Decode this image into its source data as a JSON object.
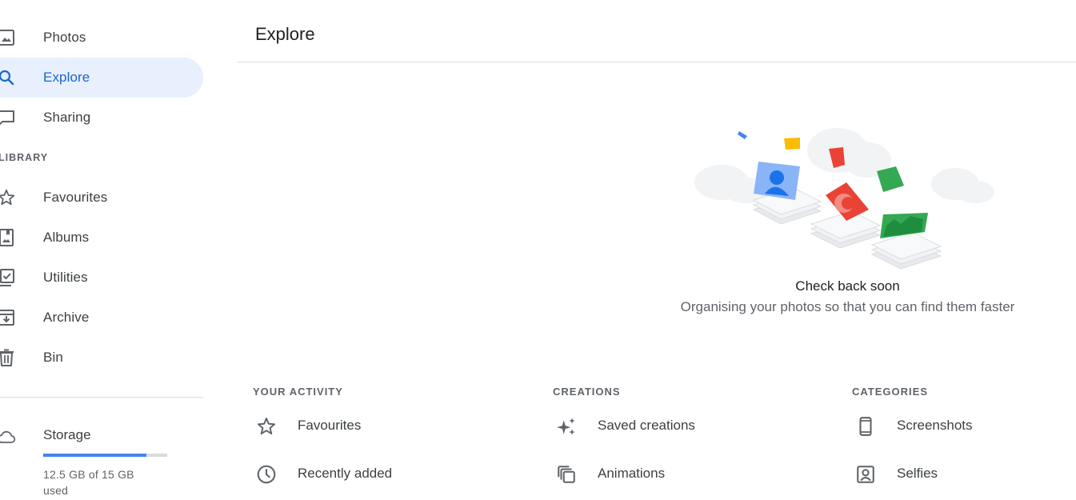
{
  "sidebar": {
    "items": [
      {
        "label": "Photos",
        "icon": "photo-icon"
      },
      {
        "label": "Explore",
        "icon": "search-icon",
        "active": true
      },
      {
        "label": "Sharing",
        "icon": "sharing-icon"
      }
    ],
    "library_label": "LIBRARY",
    "library_items": [
      {
        "label": "Favourites",
        "icon": "star-icon"
      },
      {
        "label": "Albums",
        "icon": "album-icon"
      },
      {
        "label": "Utilities",
        "icon": "utilities-icon"
      },
      {
        "label": "Archive",
        "icon": "archive-icon"
      },
      {
        "label": "Bin",
        "icon": "bin-icon"
      }
    ],
    "storage": {
      "label": "Storage",
      "usage_text": "12.5 GB of 15 GB used",
      "used_fraction": 0.833,
      "icon": "cloud-icon"
    }
  },
  "main": {
    "title": "Explore",
    "empty_state": {
      "title": "Check back soon",
      "subtitle": "Organising your photos so that you can find them faster"
    },
    "columns": [
      {
        "title": "YOUR ACTIVITY",
        "items": [
          {
            "label": "Favourites",
            "icon": "star-icon"
          },
          {
            "label": "Recently added",
            "icon": "clock-icon"
          }
        ]
      },
      {
        "title": "CREATIONS",
        "items": [
          {
            "label": "Saved creations",
            "icon": "sparkle-icon"
          },
          {
            "label": "Animations",
            "icon": "animation-icon"
          }
        ]
      },
      {
        "title": "CATEGORIES",
        "items": [
          {
            "label": "Screenshots",
            "icon": "phone-icon"
          },
          {
            "label": "Selfies",
            "icon": "selfie-icon"
          }
        ]
      }
    ]
  },
  "colors": {
    "accent": "#1967d2",
    "active_bg": "#e8f0fe",
    "storage_fill": "#4285f4",
    "text": "#3c4043",
    "muted": "#5f6368"
  }
}
